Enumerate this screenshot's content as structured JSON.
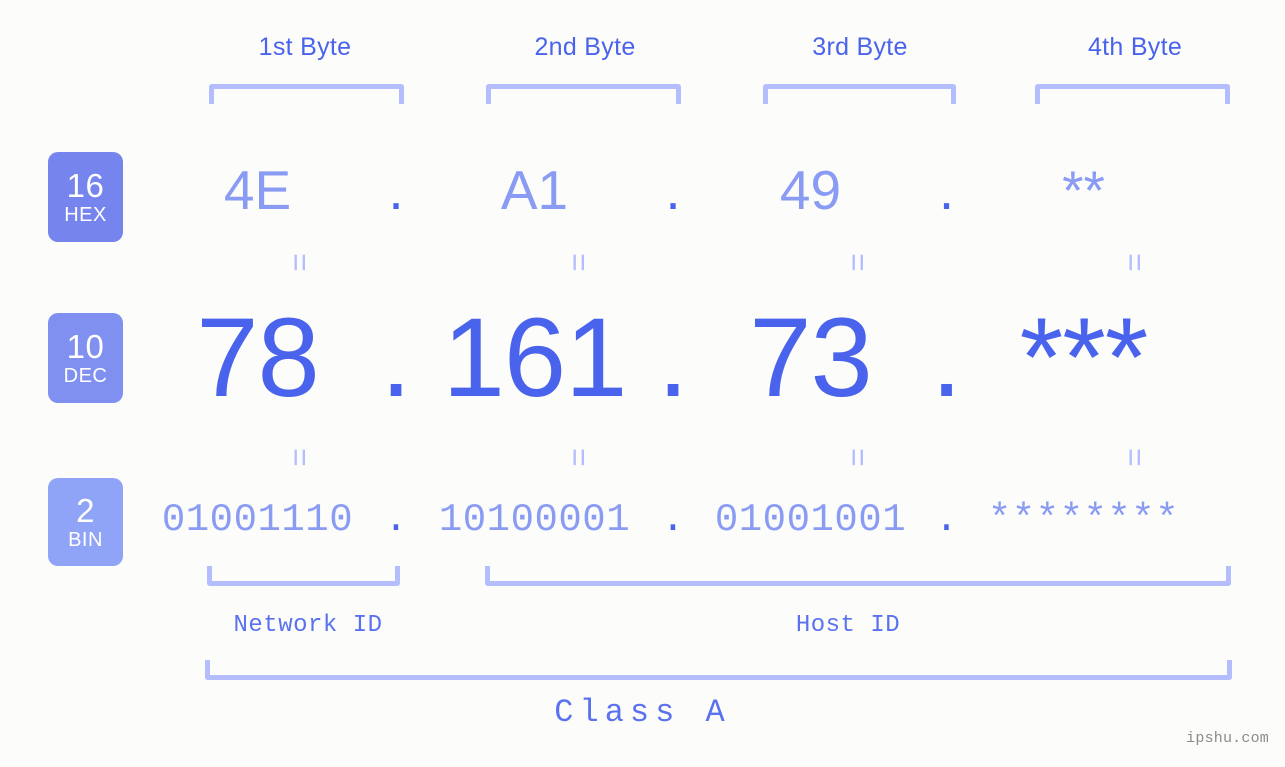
{
  "meta": {
    "background_color": "#fcfdfa",
    "accent_strong": "#4a63ec",
    "accent_light": "#8a9bf4",
    "accent_pale": "#b4beff"
  },
  "byte_headers": [
    {
      "label": "1st Byte"
    },
    {
      "label": "2nd Byte"
    },
    {
      "label": "3rd Byte"
    },
    {
      "label": "4th Byte"
    }
  ],
  "radix_badges": [
    {
      "number": "16",
      "unit": "HEX",
      "color": "#7684ee"
    },
    {
      "number": "10",
      "unit": "DEC",
      "color": "#8090f0"
    },
    {
      "number": "2",
      "unit": "BIN",
      "color": "#8fa3f7"
    }
  ],
  "rows": {
    "hex": {
      "radix": "16",
      "unit": "HEX",
      "values": [
        "4E",
        "A1",
        "49",
        "**"
      ],
      "separator": "."
    },
    "dec": {
      "radix": "10",
      "unit": "DEC",
      "values": [
        "78",
        "161",
        "73",
        "***"
      ],
      "separator": "."
    },
    "bin": {
      "radix": "2",
      "unit": "BIN",
      "values": [
        "01001110",
        "10100001",
        "01001001",
        "********"
      ],
      "separator": "."
    }
  },
  "equality_marks": {
    "glyph": "=",
    "count_per_row": 4,
    "rows": 2
  },
  "id_labels": [
    {
      "label": "Network ID"
    },
    {
      "label": "Host ID"
    }
  ],
  "class_label": "Class A",
  "watermark": "ipshu.com"
}
